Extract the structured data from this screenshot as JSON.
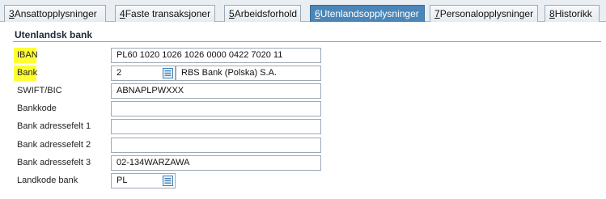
{
  "tabs": [
    {
      "num": "3",
      "rest": " Ansattopplysninger",
      "active": false
    },
    {
      "num": "4",
      "rest": " Faste transaksjoner",
      "active": false
    },
    {
      "num": "5",
      "rest": " Arbeidsforhold",
      "active": false
    },
    {
      "num": "6",
      "rest": " Utenlandsopplysninger",
      "active": true
    },
    {
      "num": "7",
      "rest": " Personalopplysninger",
      "active": false
    },
    {
      "num": "8",
      "rest": " Historikk",
      "active": false
    }
  ],
  "section": {
    "title": "Utenlandsk bank"
  },
  "fields": {
    "iban": {
      "label": "IBAN",
      "value": "PL60 1020 1026 1026 0000 0422 7020 11"
    },
    "bank": {
      "label": "Bank",
      "value": "2",
      "description": "RBS Bank (Polska) S.A.",
      "icon": "list-lookup-icon"
    },
    "swift": {
      "label": "SWIFT/BIC",
      "value": "ABNAPLPWXXX"
    },
    "bankkode": {
      "label": "Bankkode",
      "value": ""
    },
    "addr1": {
      "label": "Bank adressefelt 1",
      "value": ""
    },
    "addr2": {
      "label": "Bank adressefelt 2",
      "value": ""
    },
    "addr3": {
      "label": "Bank adressefelt 3",
      "value": "02-134WARZAWA"
    },
    "country": {
      "label": "Landkode bank",
      "value": "PL",
      "icon": "list-lookup-icon"
    }
  },
  "colors": {
    "highlight": "#ffff33",
    "active_tab": "#4a86b8",
    "lookup_icon": "#3f7fb5"
  }
}
